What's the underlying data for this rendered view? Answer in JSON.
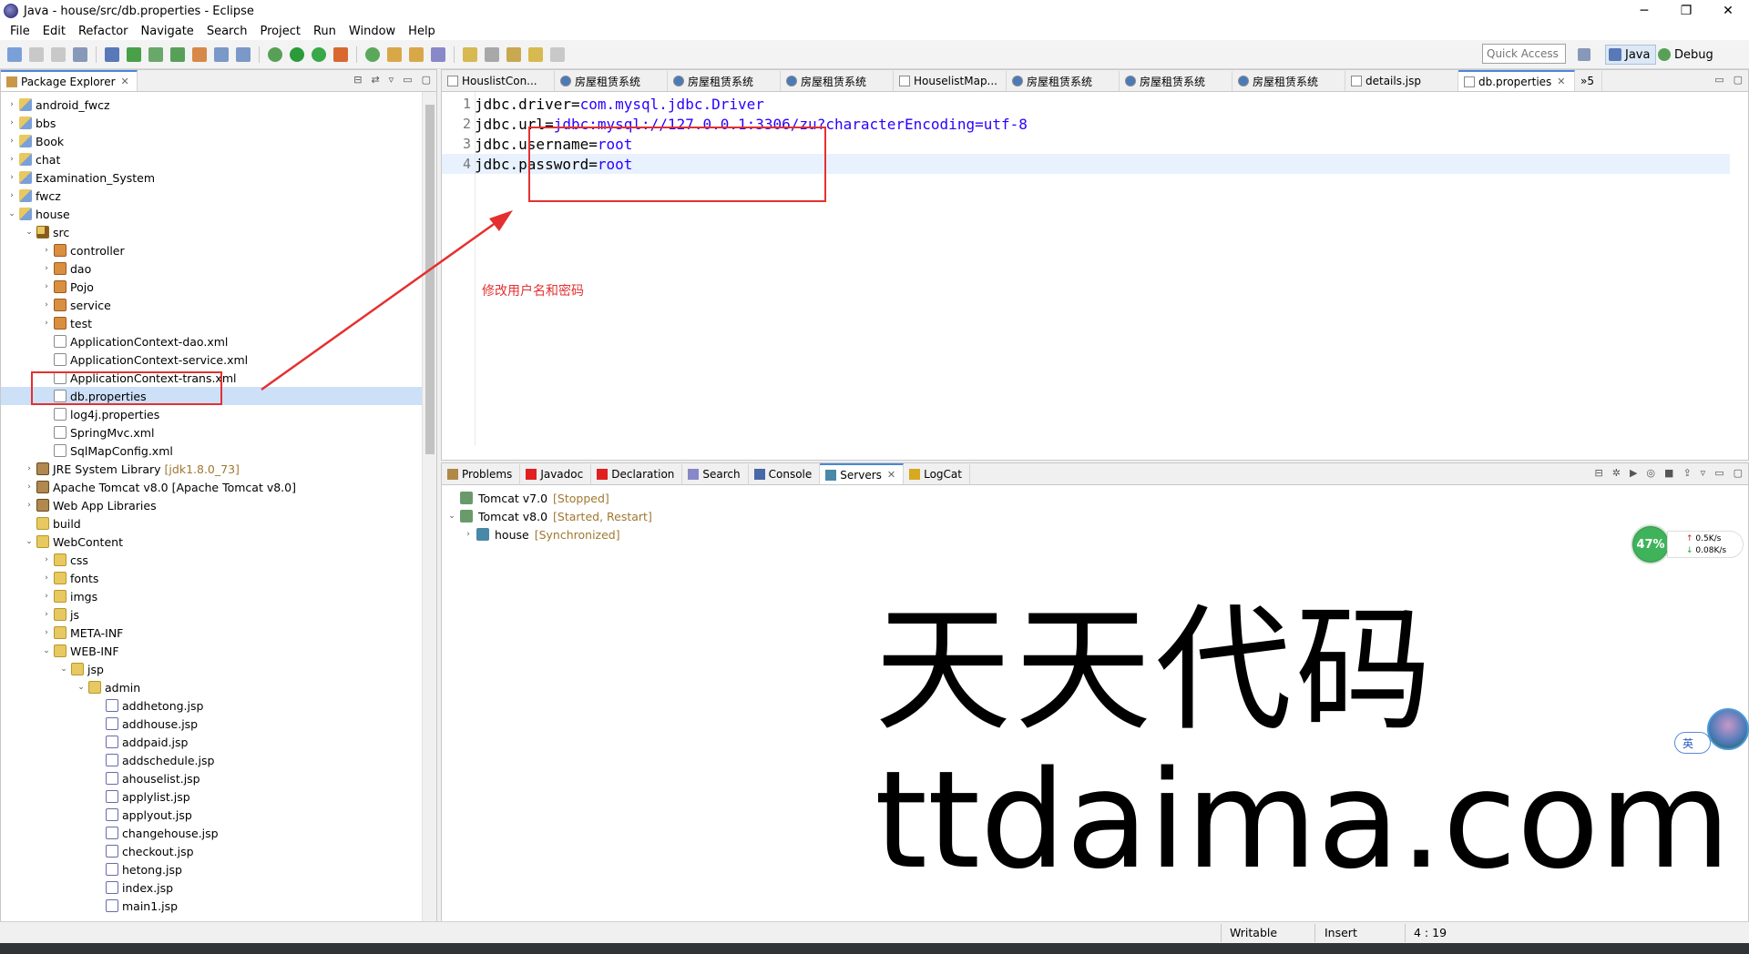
{
  "window": {
    "title": "Java - house/src/db.properties - Eclipse"
  },
  "menu": [
    "File",
    "Edit",
    "Refactor",
    "Navigate",
    "Search",
    "Project",
    "Run",
    "Window",
    "Help"
  ],
  "toolbar": {
    "quick_access": "Quick Access",
    "perspective_java": "Java",
    "perspective_debug": "Debug"
  },
  "package_explorer": {
    "tab_label": "Package Explorer",
    "tree": [
      {
        "label": "android_fwcz",
        "depth": 0,
        "arrow": "›",
        "icon": "project"
      },
      {
        "label": "bbs",
        "depth": 0,
        "arrow": "›",
        "icon": "project"
      },
      {
        "label": "Book",
        "depth": 0,
        "arrow": "›",
        "icon": "project"
      },
      {
        "label": "chat",
        "depth": 0,
        "arrow": "›",
        "icon": "project"
      },
      {
        "label": "Examination_System",
        "depth": 0,
        "arrow": "›",
        "icon": "project"
      },
      {
        "label": "fwcz",
        "depth": 0,
        "arrow": "›",
        "icon": "project"
      },
      {
        "label": "house",
        "depth": 0,
        "arrow": "⌄",
        "icon": "project"
      },
      {
        "label": "src",
        "depth": 1,
        "arrow": "⌄",
        "icon": "src"
      },
      {
        "label": "controller",
        "depth": 2,
        "arrow": "›",
        "icon": "package"
      },
      {
        "label": "dao",
        "depth": 2,
        "arrow": "›",
        "icon": "package"
      },
      {
        "label": "Pojo",
        "depth": 2,
        "arrow": "›",
        "icon": "package"
      },
      {
        "label": "service",
        "depth": 2,
        "arrow": "›",
        "icon": "package"
      },
      {
        "label": "test",
        "depth": 2,
        "arrow": "›",
        "icon": "package"
      },
      {
        "label": "ApplicationContext-dao.xml",
        "depth": 2,
        "arrow": "",
        "icon": "file"
      },
      {
        "label": "ApplicationContext-service.xml",
        "depth": 2,
        "arrow": "",
        "icon": "file"
      },
      {
        "label": "ApplicationContext-trans.xml",
        "depth": 2,
        "arrow": "",
        "icon": "file"
      },
      {
        "label": "db.properties",
        "depth": 2,
        "arrow": "",
        "icon": "file",
        "selected": true
      },
      {
        "label": "log4j.properties",
        "depth": 2,
        "arrow": "",
        "icon": "file"
      },
      {
        "label": "SpringMvc.xml",
        "depth": 2,
        "arrow": "",
        "icon": "file"
      },
      {
        "label": "SqlMapConfig.xml",
        "depth": 2,
        "arrow": "",
        "icon": "file"
      },
      {
        "label": "JRE System Library",
        "deco": "[jdk1.8.0_73]",
        "depth": 1,
        "arrow": "›",
        "icon": "lib"
      },
      {
        "label": "Apache Tomcat v8.0 [Apache Tomcat v8.0]",
        "depth": 1,
        "arrow": "›",
        "icon": "lib"
      },
      {
        "label": "Web App Libraries",
        "depth": 1,
        "arrow": "›",
        "icon": "lib"
      },
      {
        "label": "build",
        "depth": 1,
        "arrow": "",
        "icon": "folder"
      },
      {
        "label": "WebContent",
        "depth": 1,
        "arrow": "⌄",
        "icon": "folder"
      },
      {
        "label": "css",
        "depth": 2,
        "arrow": "›",
        "icon": "folder"
      },
      {
        "label": "fonts",
        "depth": 2,
        "arrow": "›",
        "icon": "folder"
      },
      {
        "label": "imgs",
        "depth": 2,
        "arrow": "›",
        "icon": "folder"
      },
      {
        "label": "js",
        "depth": 2,
        "arrow": "›",
        "icon": "folder"
      },
      {
        "label": "META-INF",
        "depth": 2,
        "arrow": "›",
        "icon": "folder"
      },
      {
        "label": "WEB-INF",
        "depth": 2,
        "arrow": "⌄",
        "icon": "folder"
      },
      {
        "label": "jsp",
        "depth": 3,
        "arrow": "⌄",
        "icon": "folder"
      },
      {
        "label": "admin",
        "depth": 4,
        "arrow": "⌄",
        "icon": "folder"
      },
      {
        "label": "addhetong.jsp",
        "depth": 5,
        "arrow": "",
        "icon": "jsp"
      },
      {
        "label": "addhouse.jsp",
        "depth": 5,
        "arrow": "",
        "icon": "jsp"
      },
      {
        "label": "addpaid.jsp",
        "depth": 5,
        "arrow": "",
        "icon": "jsp"
      },
      {
        "label": "addschedule.jsp",
        "depth": 5,
        "arrow": "",
        "icon": "jsp"
      },
      {
        "label": "ahouselist.jsp",
        "depth": 5,
        "arrow": "",
        "icon": "jsp"
      },
      {
        "label": "applylist.jsp",
        "depth": 5,
        "arrow": "",
        "icon": "jsp"
      },
      {
        "label": "applyout.jsp",
        "depth": 5,
        "arrow": "",
        "icon": "jsp"
      },
      {
        "label": "changehouse.jsp",
        "depth": 5,
        "arrow": "",
        "icon": "jsp"
      },
      {
        "label": "checkout.jsp",
        "depth": 5,
        "arrow": "",
        "icon": "jsp"
      },
      {
        "label": "hetong.jsp",
        "depth": 5,
        "arrow": "",
        "icon": "jsp"
      },
      {
        "label": "index.jsp",
        "depth": 5,
        "arrow": "",
        "icon": "jsp"
      },
      {
        "label": "main1.jsp",
        "depth": 5,
        "arrow": "",
        "icon": "jsp"
      }
    ]
  },
  "editor": {
    "tabs": [
      {
        "label": "HouslistCon..."
      },
      {
        "label": "房屋租赁系统"
      },
      {
        "label": "房屋租赁系统"
      },
      {
        "label": "房屋租赁系统"
      },
      {
        "label": "HouselistMap..."
      },
      {
        "label": "房屋租赁系统"
      },
      {
        "label": "房屋租赁系统"
      },
      {
        "label": "房屋租赁系统"
      },
      {
        "label": "details.jsp"
      },
      {
        "label": "db.properties",
        "active": true
      }
    ],
    "overflow": "»5",
    "lines": [
      {
        "num": "1",
        "key": "jdbc.driver=",
        "value": "com.mysql.jdbc.Driver"
      },
      {
        "num": "2",
        "key": "jdbc.url=",
        "value": "jdbc:mysql://127.0.0.1:3306/zu?characterEncoding=utf-8"
      },
      {
        "num": "3",
        "key": "jdbc.username=",
        "value": "root"
      },
      {
        "num": "4",
        "key": "jdbc.password=",
        "value": "root"
      }
    ],
    "annotation": "修改用户名和密码"
  },
  "bottom_panel": {
    "tabs": [
      "Problems",
      "Javadoc",
      "Declaration",
      "Search",
      "Console",
      "Servers",
      "LogCat"
    ],
    "active_tab": "Servers",
    "servers": [
      {
        "name": "Tomcat v7.0",
        "state": "[Stopped]",
        "depth": 0,
        "arrow": ""
      },
      {
        "name": "Tomcat v8.0",
        "state": "[Started, Restart]",
        "depth": 0,
        "arrow": "⌄"
      },
      {
        "name": "house",
        "state": "[Synchronized]",
        "depth": 1,
        "arrow": "›"
      }
    ]
  },
  "status": {
    "writable": "Writable",
    "insert": "Insert",
    "position": "4 : 19"
  },
  "overlay": {
    "watermark_cn": "天天代码",
    "watermark_en": "ttdaima.com",
    "net_percent": "47%",
    "upload": "0.5K/s",
    "download": "0.08K/s",
    "ime": "英"
  },
  "colors": {
    "accent": "#4a88d8",
    "annotation": "#e53030",
    "property_value": "#2a00ff",
    "selection": "#cce0f8"
  }
}
